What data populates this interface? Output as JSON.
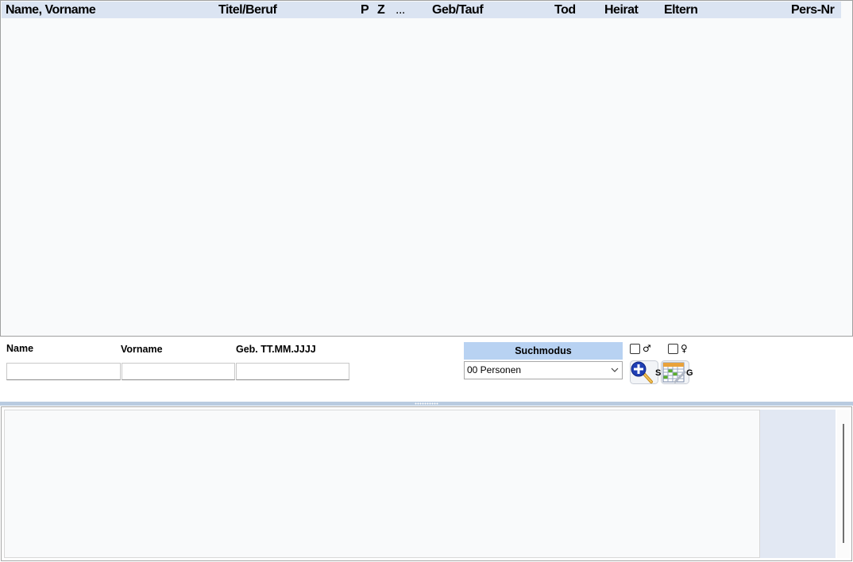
{
  "person_list": {
    "columns": [
      {
        "key": "name",
        "label": "Name, Vorname"
      },
      {
        "key": "titel",
        "label": "Titel/Beruf"
      },
      {
        "key": "p",
        "label": "P"
      },
      {
        "key": "z",
        "label": "Z"
      },
      {
        "key": "more",
        "label": "..."
      },
      {
        "key": "geb",
        "label": "Geb/Tauf"
      },
      {
        "key": "tod",
        "label": "Tod"
      },
      {
        "key": "heirat",
        "label": "Heirat"
      },
      {
        "key": "eltern",
        "label": "Eltern"
      },
      {
        "key": "persnr",
        "label": "Pers-Nr"
      }
    ],
    "rows": []
  },
  "search": {
    "name_label": "Name",
    "vorname_label": "Vorname",
    "geb_label": "Geb. TT.MM.JJJJ",
    "name_value": "",
    "vorname_value": "",
    "geb_value": "",
    "mode_label": "Suchmodus",
    "mode_selected": "00 Personen",
    "male_symbol": "♂",
    "female_symbol": "♀",
    "male_checked": false,
    "female_checked": false,
    "search_button_letter": "S",
    "grid_button_letter": "G"
  },
  "colors": {
    "header_bg": "#dbe4f2",
    "mode_label_bg": "#b8d2f2",
    "list_bg": "#f9fafb",
    "splitter": "#b9cbe0",
    "side_panel_bg": "#e2e8f3"
  },
  "icons": {
    "search_button": "magnifier-plus-icon",
    "grid_button": "grid-table-icon",
    "dropdown": "chevron-down-icon"
  }
}
